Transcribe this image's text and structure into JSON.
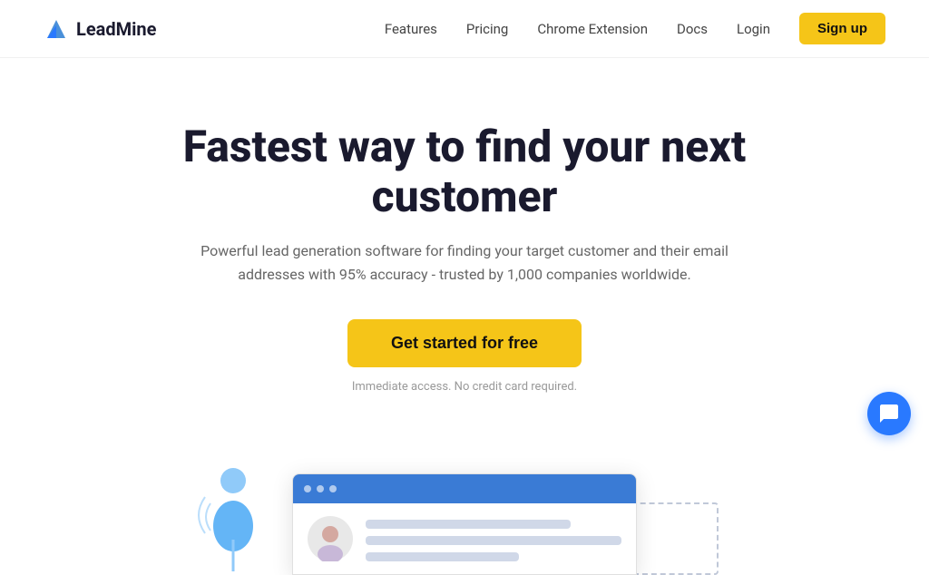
{
  "header": {
    "logo_text": "LeadMine",
    "nav": {
      "features_label": "Features",
      "pricing_label": "Pricing",
      "chrome_ext_label": "Chrome Extension",
      "docs_label": "Docs",
      "login_label": "Login",
      "signup_label": "Sign up"
    }
  },
  "hero": {
    "title": "Fastest way to find your next customer",
    "subtitle": "Powerful lead generation software for finding your target customer and their email addresses with 95% accuracy - trusted by 1,000 companies worldwide.",
    "cta_label": "Get started for free",
    "cta_note": "Immediate access. No credit card required."
  },
  "chat": {
    "icon": "chat-icon"
  }
}
